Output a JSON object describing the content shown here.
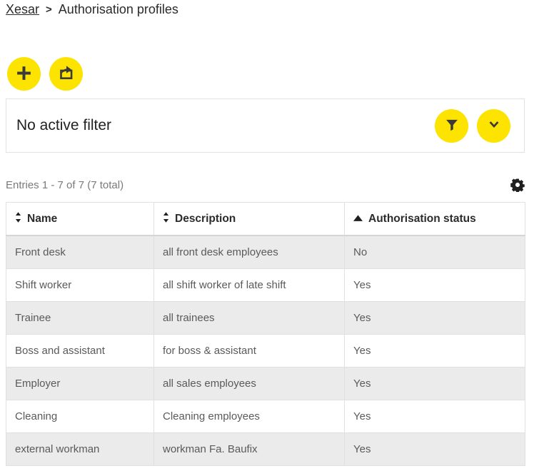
{
  "breadcrumb": {
    "root_label": "Xesar",
    "separator": ">",
    "current_label": "Authorisation profiles"
  },
  "toolbar": {
    "add_label": "add-profile",
    "export_label": "export-profiles",
    "add_icon": "plus-icon",
    "export_icon": "export-icon"
  },
  "filter": {
    "status_text": "No active filter",
    "filter_button_icon": "funnel-icon",
    "expand_button_icon": "chevron-down-icon"
  },
  "entries": {
    "summary": "Entries 1 - 7 of 7 (7 total)",
    "settings_icon": "gear-icon"
  },
  "table": {
    "columns": [
      {
        "label": "Name",
        "sort": "none"
      },
      {
        "label": "Description",
        "sort": "none"
      },
      {
        "label": "Authorisation status",
        "sort": "asc"
      }
    ],
    "rows": [
      {
        "name": "Front desk",
        "description": "all front desk employees",
        "status": "No"
      },
      {
        "name": "Shift worker",
        "description": "all shift worker of late shift",
        "status": "Yes"
      },
      {
        "name": "Trainee",
        "description": "all trainees",
        "status": "Yes"
      },
      {
        "name": "Boss and assistant",
        "description": "for boss & assistant",
        "status": "Yes"
      },
      {
        "name": "Employer",
        "description": "all sales employees",
        "status": "Yes"
      },
      {
        "name": "Cleaning",
        "description": "Cleaning employees",
        "status": "Yes"
      },
      {
        "name": "external workman",
        "description": "workman Fa. Baufix",
        "status": "Yes"
      }
    ]
  },
  "colors": {
    "accent_yellow": "#fce300",
    "icon_dark": "#3a3a3a",
    "row_alt": "#ebebeb",
    "border": "#e0e0e0"
  }
}
